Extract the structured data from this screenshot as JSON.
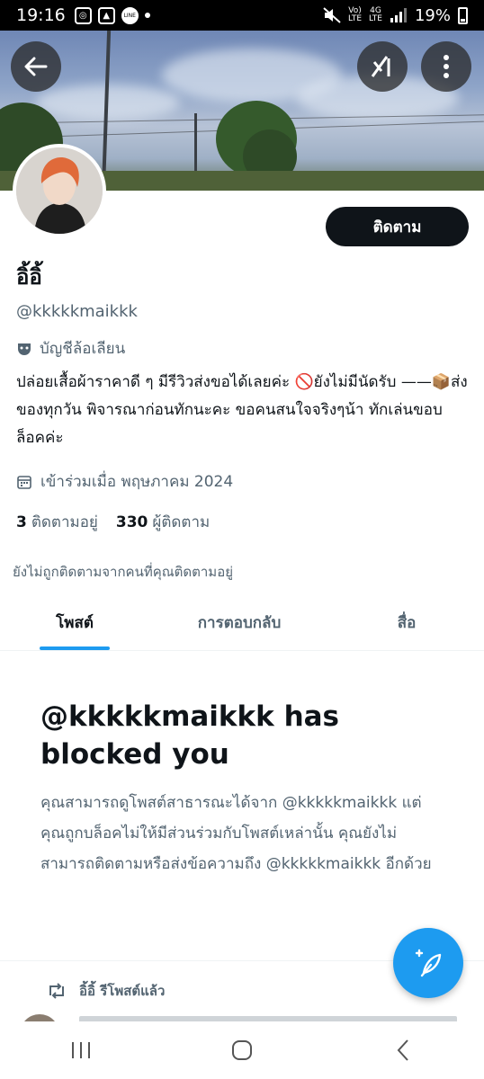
{
  "status_bar": {
    "time": "19:16",
    "network_top": "Vo)",
    "network_bottom": "LTE",
    "signal_top": "4G",
    "signal_bottom": "LTE",
    "battery": "19%"
  },
  "profile": {
    "display_name": "อิ้อิ้",
    "handle": "@kkkkkmaikkk",
    "parody_label": "บัญชีล้อเลียน",
    "bio": "ปล่อยเสื้อผ้าราคาดี ๆ มีรีวิวส่งขอได้เลยค่ะ 🚫ยังไม่มีนัดรับ ——📦ส่งของทุกวัน พิจารณาก่อนทักนะคะ ขอคนสนใจจริงๆน้า ทักเล่นขอบล็อคค่ะ",
    "joined": "เข้าร่วมเมื่อ พฤษภาคม 2024",
    "following_count": "3",
    "following_label": "ติดตามอยู่",
    "followers_count": "330",
    "followers_label": "ผู้ติดตาม",
    "not_followed_note": "ยังไม่ถูกติดตามจากคนที่คุณติดตามอยู่",
    "follow_button": "ติดตาม"
  },
  "tabs": [
    {
      "label": "โพสต์",
      "active": true
    },
    {
      "label": "การตอบกลับ",
      "active": false
    },
    {
      "label": "สื่อ",
      "active": false
    }
  ],
  "blocked": {
    "title": "@kkkkkmaikkk has blocked you",
    "text": "คุณสามารถดูโพสต์สาธารณะได้จาก @kkkkkmaikkk แต่คุณถูกบล็อคไม่ให้มีส่วนร่วมกับโพสต์เหล่านั้น คุณยังไม่สามารถติดตามหรือส่งข้อความถึง @kkkkkmaikkk อีกด้วย"
  },
  "repost": {
    "label": "อิ้อิ้ รีโพสต์แล้ว"
  },
  "icons": {
    "back": "arrow-left-icon",
    "grok": "grok-icon",
    "more": "more-vertical-icon",
    "parody": "mask-icon",
    "calendar": "calendar-icon",
    "repost": "repost-icon",
    "compose": "compose-feather-icon",
    "nav_recent": "recent-apps-icon",
    "nav_home": "home-icon",
    "nav_back": "back-chevron-icon"
  },
  "colors": {
    "accent": "#1d9bf0",
    "text_primary": "#0f1419",
    "text_secondary": "#536471"
  }
}
